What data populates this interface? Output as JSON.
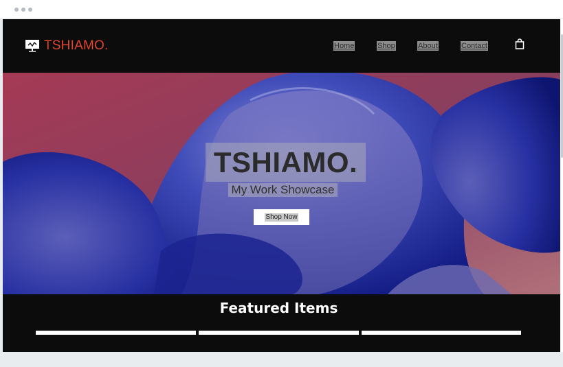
{
  "brand": {
    "name": "TSHIAMO.",
    "color": "#e2452e"
  },
  "nav": {
    "items": [
      "Home",
      "Shop",
      "About",
      "Contact"
    ]
  },
  "hero": {
    "title": "TSHIAMO.",
    "subtitle": "My Work Showcase",
    "button_label": "Shop Now"
  },
  "featured": {
    "title": "Featured Items",
    "card_count": 3
  },
  "colors": {
    "header_bg": "#0c0c0c",
    "hero_accent": "#2636a8"
  },
  "icons": {
    "logo": "presentation-board-icon",
    "cart": "shopping-bag-icon"
  }
}
